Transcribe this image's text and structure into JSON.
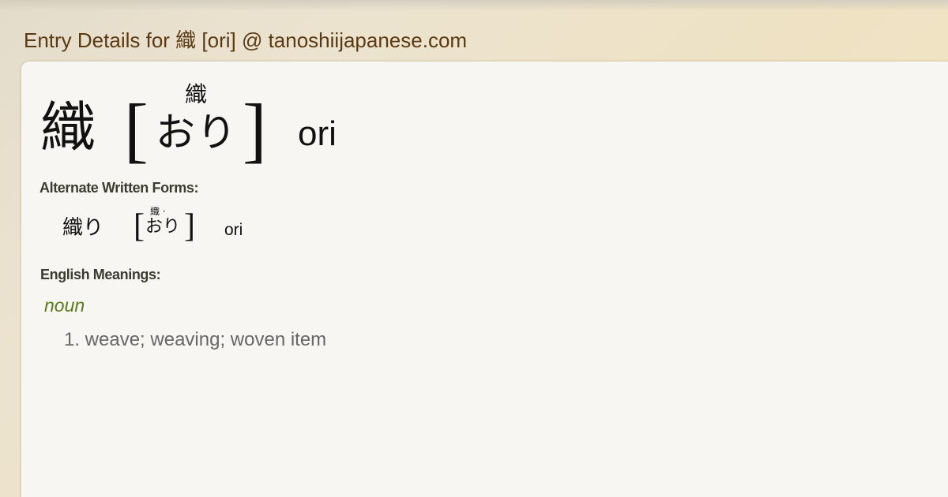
{
  "page": {
    "title": "Entry Details for 織 [ori] @ tanoshiijapanese.com"
  },
  "entry": {
    "kanji": "織",
    "bracket_open": "[",
    "bracket_close": "]",
    "furigana": "織",
    "kana": "おり",
    "romaji": "ori"
  },
  "alternate_forms": {
    "label": "Alternate Written Forms:",
    "items": [
      {
        "written": "織り",
        "bracket_open": "[",
        "bracket_close": "]",
        "furigana": "織 ·",
        "kana": "おり",
        "romaji": "ori"
      }
    ]
  },
  "meanings": {
    "label": "English Meanings:",
    "part_of_speech": "noun",
    "items": [
      "1. weave; weaving; woven item"
    ]
  },
  "colors": {
    "title": "#5a3a12",
    "part_of_speech": "#5a7a1a",
    "meaning_text": "#666666",
    "card_background": "#f7f6f2"
  }
}
